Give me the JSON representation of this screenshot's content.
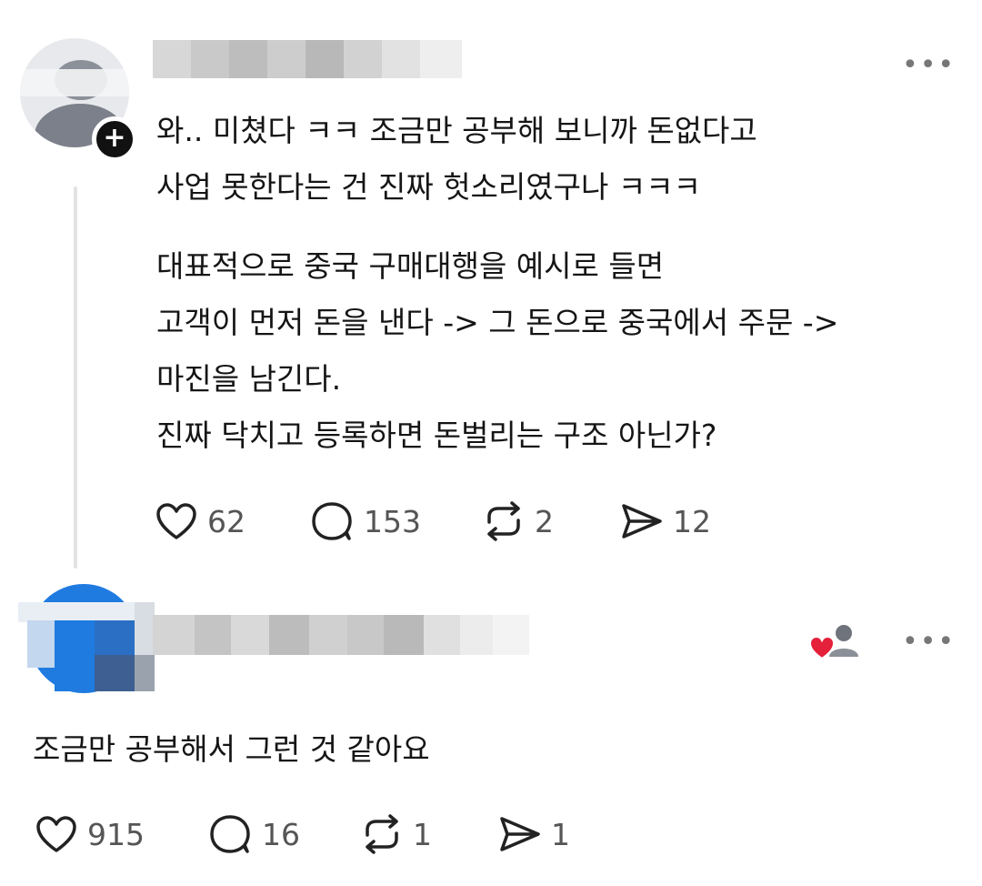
{
  "post": {
    "text_lines": [
      "와.. 미쳤다 ㅋㅋ 조금만 공부해 보니까 돈없다고",
      "사업 못한다는 건 진짜 헛소리였구나 ㅋㅋㅋ",
      "대표적으로 중국 구매대행을 예시로 들면",
      "고객이 먼저 돈을 낸다 -> 그 돈으로 중국에서 주문 ->",
      "마진을 남긴다.",
      "진짜 닥치고 등록하면 돈벌리는 구조 아닌가?"
    ],
    "stats": {
      "likes": "62",
      "replies": "153",
      "reposts": "2",
      "shares": "12"
    },
    "follow_icon": "plus-icon",
    "more_label": "•••"
  },
  "reply": {
    "text": "조금만 공부해서 그런 것 같아요",
    "stats": {
      "likes": "915",
      "replies": "16",
      "reposts": "1",
      "shares": "1"
    },
    "more_label": "•••",
    "liked_by_icon": "heart-person-icon"
  },
  "colors": {
    "heart_red": "#e5203a",
    "text": "#151515",
    "muted": "#555555",
    "avatar_blue": "#1f7be0"
  }
}
